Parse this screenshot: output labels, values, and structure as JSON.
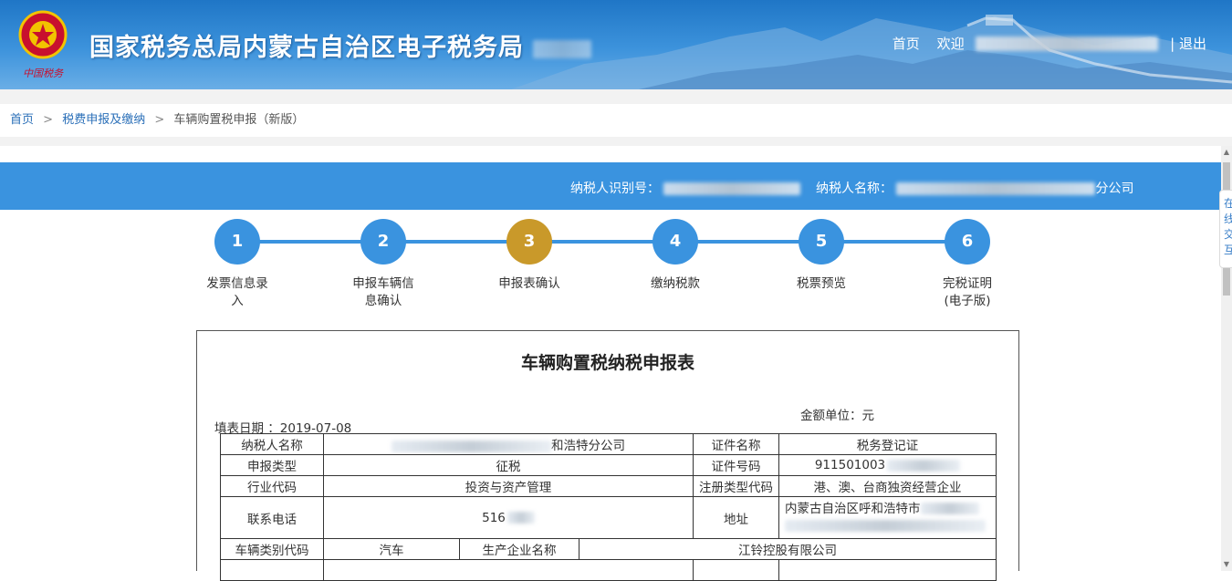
{
  "header": {
    "site_title": "国家税务总局内蒙古自治区电子税务局",
    "nav_home": "首页",
    "nav_welcome": "欢迎",
    "nav_logout": "| 退出"
  },
  "breadcrumb": {
    "home": "首页",
    "section": "税费申报及缴纳",
    "current": "车辆购置税申报（新版）",
    "separator": ">"
  },
  "taxpayer_bar": {
    "id_label": "纳税人识别号：",
    "name_label": "纳税人名称：",
    "name_suffix": "分公司"
  },
  "steps": [
    {
      "num": "1",
      "label_line1": "发票信息录",
      "label_line2": "入",
      "active": false
    },
    {
      "num": "2",
      "label_line1": "申报车辆信",
      "label_line2": "息确认",
      "active": false
    },
    {
      "num": "3",
      "label_line1": "申报表确认",
      "label_line2": "",
      "active": true
    },
    {
      "num": "4",
      "label_line1": "缴纳税款",
      "label_line2": "",
      "active": false
    },
    {
      "num": "5",
      "label_line1": "税票预览",
      "label_line2": "",
      "active": false
    },
    {
      "num": "6",
      "label_line1": "完税证明",
      "label_line2": "(电子版)",
      "active": false
    }
  ],
  "float_panel": {
    "text": "在线交互"
  },
  "form": {
    "title": "车辆购置税纳税申报表",
    "unit": "金额单位：元",
    "fill_date": "填表日期 ：2019-07-08",
    "rows": {
      "taxpayer_name_label": "纳税人名称",
      "taxpayer_name_value": "和浩特分公司",
      "cert_name_label": "证件名称",
      "cert_name_value": "税务登记证",
      "decl_type_label": "申报类型",
      "decl_type_value": "征税",
      "cert_no_label": "证件号码",
      "cert_no_value": "911501003",
      "industry_label": "行业代码",
      "industry_value": "投资与资产管理",
      "reg_type_label": "注册类型代码",
      "reg_type_value": "港、澳、台商独资经营企业",
      "phone_label": "联系电话",
      "phone_value": "516",
      "address_label": "地址",
      "address_value": "内蒙古自治区呼和浩特市",
      "vehicle_cat_label": "车辆类别代码",
      "vehicle_cat_value": "汽车",
      "manufacturer_label": "生产企业名称",
      "manufacturer_value": "江铃控股有限公司"
    }
  },
  "colors": {
    "primary_blue": "#3a93df",
    "active_step": "#c9992a",
    "link": "#2a6fb8"
  }
}
